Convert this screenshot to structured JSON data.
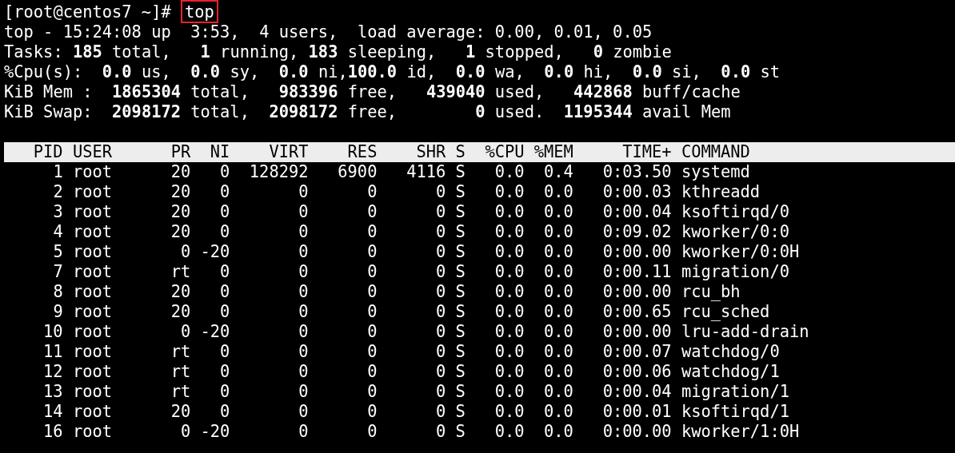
{
  "prompt": {
    "text": "[root@centos7 ~]#",
    "command": "top"
  },
  "summary": [
    "top - 15:24:08 up  3:53,  4 users,  load average: 0.00, 0.01, 0.05",
    "Tasks: **185** total,   **1** running, **183** sleeping,   **1** stopped,   **0** zombie",
    "%Cpu(s):  **0.0** us,  **0.0** sy,  **0.0** ni,**100.0** id,  **0.0** wa,  **0.0** hi,  **0.0** si,  **0.0** st",
    "KiB Mem :  **1865304** total,   **983396** free,   **439040** used,   **442868** buff/cache",
    "KiB Swap:  **2098172** total,  **2098172** free,        **0** used.  **1195344** avail Mem"
  ],
  "table": {
    "columns": [
      "PID",
      "USER",
      "PR",
      "NI",
      "VIRT",
      "RES",
      "SHR",
      "S",
      "%CPU",
      "%MEM",
      "TIME+",
      "COMMAND"
    ],
    "rows": [
      [
        "1",
        "root",
        "20",
        "0",
        "128292",
        "6900",
        "4116",
        "S",
        "0.0",
        "0.4",
        "0:03.50",
        "systemd"
      ],
      [
        "2",
        "root",
        "20",
        "0",
        "0",
        "0",
        "0",
        "S",
        "0.0",
        "0.0",
        "0:00.03",
        "kthreadd"
      ],
      [
        "3",
        "root",
        "20",
        "0",
        "0",
        "0",
        "0",
        "S",
        "0.0",
        "0.0",
        "0:00.04",
        "ksoftirqd/0"
      ],
      [
        "4",
        "root",
        "20",
        "0",
        "0",
        "0",
        "0",
        "S",
        "0.0",
        "0.0",
        "0:09.02",
        "kworker/0:0"
      ],
      [
        "5",
        "root",
        "0",
        "-20",
        "0",
        "0",
        "0",
        "S",
        "0.0",
        "0.0",
        "0:00.00",
        "kworker/0:0H"
      ],
      [
        "7",
        "root",
        "rt",
        "0",
        "0",
        "0",
        "0",
        "S",
        "0.0",
        "0.0",
        "0:00.11",
        "migration/0"
      ],
      [
        "8",
        "root",
        "20",
        "0",
        "0",
        "0",
        "0",
        "S",
        "0.0",
        "0.0",
        "0:00.00",
        "rcu_bh"
      ],
      [
        "9",
        "root",
        "20",
        "0",
        "0",
        "0",
        "0",
        "S",
        "0.0",
        "0.0",
        "0:00.65",
        "rcu_sched"
      ],
      [
        "10",
        "root",
        "0",
        "-20",
        "0",
        "0",
        "0",
        "S",
        "0.0",
        "0.0",
        "0:00.00",
        "lru-add-drain"
      ],
      [
        "11",
        "root",
        "rt",
        "0",
        "0",
        "0",
        "0",
        "S",
        "0.0",
        "0.0",
        "0:00.07",
        "watchdog/0"
      ],
      [
        "12",
        "root",
        "rt",
        "0",
        "0",
        "0",
        "0",
        "S",
        "0.0",
        "0.0",
        "0:00.06",
        "watchdog/1"
      ],
      [
        "13",
        "root",
        "rt",
        "0",
        "0",
        "0",
        "0",
        "S",
        "0.0",
        "0.0",
        "0:00.04",
        "migration/1"
      ],
      [
        "14",
        "root",
        "20",
        "0",
        "0",
        "0",
        "0",
        "S",
        "0.0",
        "0.0",
        "0:00.01",
        "ksoftirqd/1"
      ],
      [
        "16",
        "root",
        "0",
        "-20",
        "0",
        "0",
        "0",
        "S",
        "0.0",
        "0.0",
        "0:00.00",
        "kworker/1:0H"
      ]
    ]
  }
}
